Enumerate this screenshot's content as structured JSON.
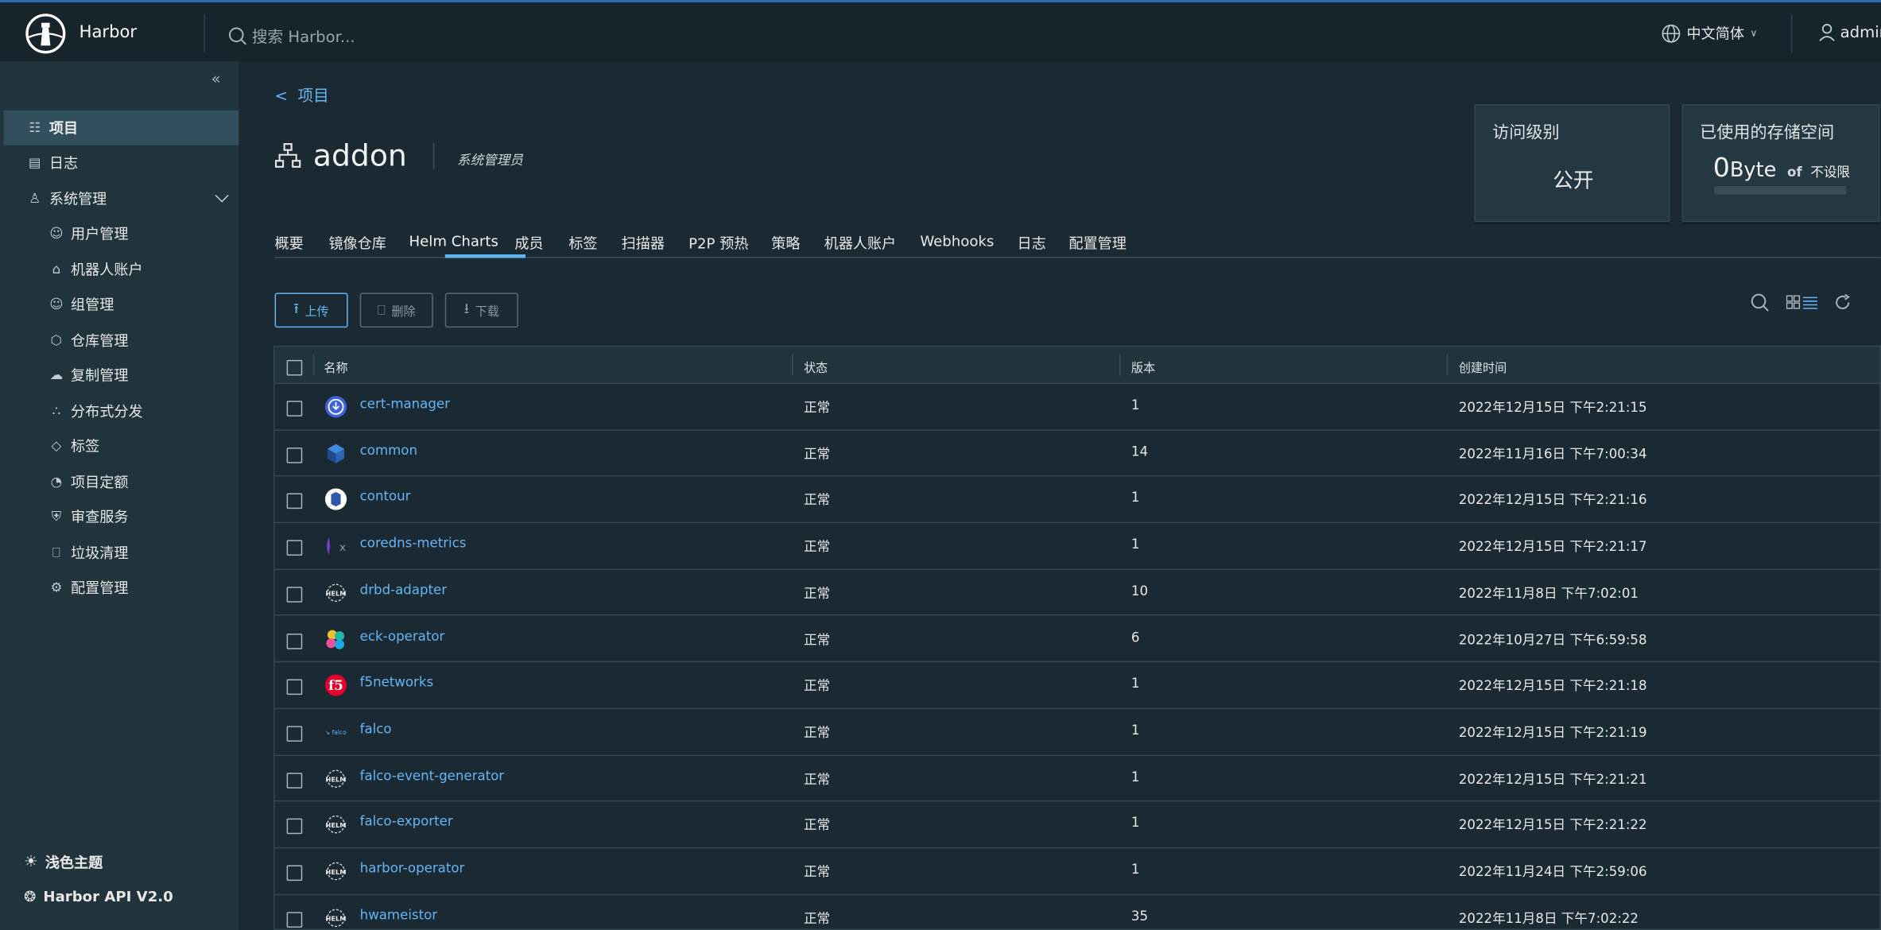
{
  "header": {
    "brand": "Harbor",
    "search_placeholder": "搜索 Harbor...",
    "language": "中文简体",
    "user": "admin"
  },
  "sidebar": {
    "items": [
      {
        "label": "项目",
        "icon": "project-icon",
        "active": true
      },
      {
        "label": "日志",
        "icon": "log-icon"
      },
      {
        "label": "系统管理",
        "icon": "admin-icon",
        "expanded": true
      }
    ],
    "sub_items": [
      {
        "label": "用户管理",
        "icon": "users-icon"
      },
      {
        "label": "机器人账户",
        "icon": "robot-icon"
      },
      {
        "label": "组管理",
        "icon": "group-icon"
      },
      {
        "label": "仓库管理",
        "icon": "registry-icon"
      },
      {
        "label": "复制管理",
        "icon": "replication-icon"
      },
      {
        "label": "分布式分发",
        "icon": "distribution-icon"
      },
      {
        "label": "标签",
        "icon": "tag-icon"
      },
      {
        "label": "项目定额",
        "icon": "quota-icon"
      },
      {
        "label": "审查服务",
        "icon": "shield-icon"
      },
      {
        "label": "垃圾清理",
        "icon": "trash-icon"
      },
      {
        "label": "配置管理",
        "icon": "gear-icon"
      }
    ],
    "theme": "浅色主题",
    "api": "Harbor API V2.0"
  },
  "main": {
    "back_label": "项目",
    "project_name": "addon",
    "role": "系统管理员",
    "access_card": {
      "title": "访问级别",
      "value": "公开"
    },
    "storage_card": {
      "title": "已使用的存储空间",
      "value_num": "0",
      "value_unit": "Byte",
      "of": "of",
      "limit": "不设限"
    },
    "tabs": [
      "概要",
      "镜像仓库",
      "Helm Charts",
      "成员",
      "标签",
      "扫描器",
      "P2P 预热",
      "策略",
      "机器人账户",
      "Webhooks",
      "日志",
      "配置管理"
    ],
    "active_tab": "Helm Charts",
    "buttons": {
      "upload": "上传",
      "delete": "删除",
      "download": "下载"
    },
    "columns": [
      "名称",
      "状态",
      "版本",
      "创建时间"
    ],
    "rows": [
      {
        "name": "cert-manager",
        "status": "正常",
        "version": "1",
        "created": "2022年12月15日 下午2:21:15",
        "icon": "cert-manager"
      },
      {
        "name": "common",
        "status": "正常",
        "version": "14",
        "created": "2022年11月16日 下午7:00:34",
        "icon": "cube"
      },
      {
        "name": "contour",
        "status": "正常",
        "version": "1",
        "created": "2022年12月15日 下午2:21:16",
        "icon": "contour"
      },
      {
        "name": "coredns-metrics",
        "status": "正常",
        "version": "1",
        "created": "2022年12月15日 下午2:21:17",
        "icon": "coredns"
      },
      {
        "name": "drbd-adapter",
        "status": "正常",
        "version": "10",
        "created": "2022年11月8日 下午7:02:01",
        "icon": "helm"
      },
      {
        "name": "eck-operator",
        "status": "正常",
        "version": "6",
        "created": "2022年10月27日 下午6:59:58",
        "icon": "elastic"
      },
      {
        "name": "f5networks",
        "status": "正常",
        "version": "1",
        "created": "2022年12月15日 下午2:21:18",
        "icon": "f5"
      },
      {
        "name": "falco",
        "status": "正常",
        "version": "1",
        "created": "2022年12月15日 下午2:21:19",
        "icon": "falco"
      },
      {
        "name": "falco-event-generator",
        "status": "正常",
        "version": "1",
        "created": "2022年12月15日 下午2:21:21",
        "icon": "helm"
      },
      {
        "name": "falco-exporter",
        "status": "正常",
        "version": "1",
        "created": "2022年12月15日 下午2:21:22",
        "icon": "helm"
      },
      {
        "name": "harbor-operator",
        "status": "正常",
        "version": "1",
        "created": "2022年11月24日 下午2:59:06",
        "icon": "helm"
      },
      {
        "name": "hwameistor",
        "status": "正常",
        "version": "35",
        "created": "2022年11月8日 下午7:02:22",
        "icon": "helm"
      }
    ]
  },
  "colors": {
    "accent": "#64b5f6",
    "header_bg": "#17242b",
    "sidebar_bg": "#21333b",
    "main_bg": "#1b2a32"
  }
}
